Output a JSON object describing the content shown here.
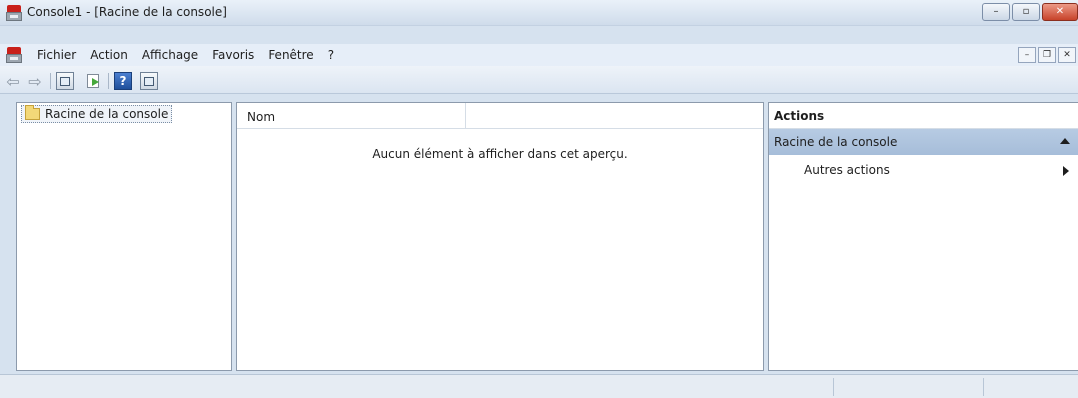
{
  "window": {
    "title": "Console1 - [Racine de la console]",
    "controls": {
      "minimize": "–",
      "maximize": "▫",
      "close": "✕"
    }
  },
  "menubar": {
    "items": [
      "Fichier",
      "Action",
      "Affichage",
      "Favoris",
      "Fenêtre",
      "?"
    ],
    "mdi_controls": {
      "minimize": "–",
      "restore": "❐",
      "close": "✕"
    }
  },
  "toolbar": {
    "icons": [
      "back-arrow-icon",
      "forward-arrow-icon",
      "show-hide-tree-icon",
      "export-list-icon",
      "help-icon",
      "show-hide-action-pane-icon"
    ],
    "back_glyph": "⇦",
    "forward_glyph": "⇨",
    "help_glyph": "?"
  },
  "tree": {
    "root_label": "Racine de la console"
  },
  "list": {
    "columns": [
      "Nom",
      ""
    ],
    "empty_message": "Aucun élément à afficher dans cet aperçu."
  },
  "actions_pane": {
    "header": "Actions",
    "section_title": "Racine de la console",
    "items": [
      "Autres actions"
    ]
  },
  "statusbar": {
    "cells": [
      "",
      "",
      ""
    ]
  },
  "colors": {
    "section_highlight": "#b7cbe3",
    "close_button": "#c7432a",
    "window_frame": "#d6e2ef"
  }
}
